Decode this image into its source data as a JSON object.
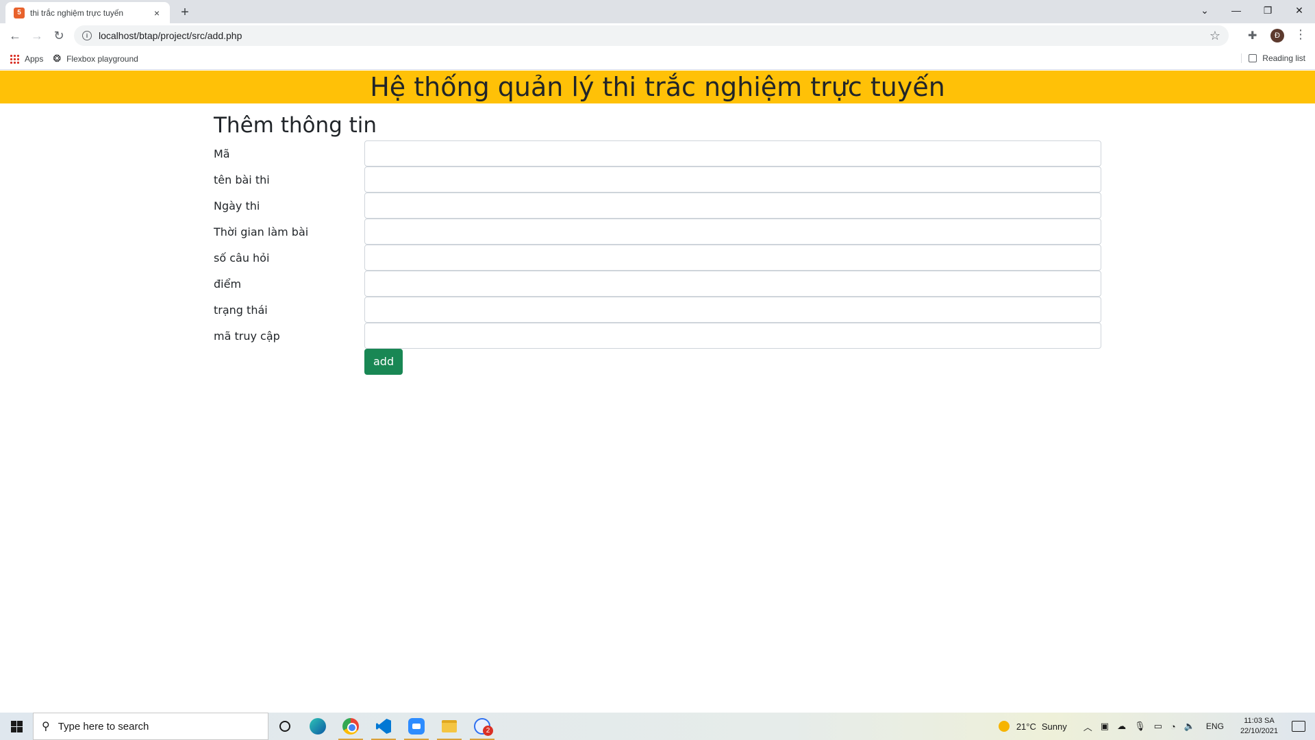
{
  "browser": {
    "tab_title": "thi trắc nghiệm trực tuyến",
    "tab_favicon": "html-icon",
    "tab_close": "×",
    "new_tab": "+",
    "url": "localhost/btap/project/src/add.php",
    "profile_initial": "Đ",
    "window_controls": {
      "tab_search": "⌄",
      "minimize": "—",
      "restore": "❐",
      "close": "✕"
    },
    "bookmarks": [
      {
        "label": "Apps",
        "icon": "apps-grid-icon"
      },
      {
        "label": "Flexbox playground",
        "icon": "flexbox-icon"
      }
    ],
    "reading_list": "Reading list"
  },
  "page": {
    "header_title": "Hệ thống quản lý thi trắc nghiệm trực tuyến",
    "header_color": "#ffc107",
    "form_title": "Thêm thông tin",
    "fields": [
      {
        "label": "Mã",
        "value": ""
      },
      {
        "label": "tên bài thi",
        "value": ""
      },
      {
        "label": "Ngày thi",
        "value": ""
      },
      {
        "label": "Thời gian làm bài",
        "value": ""
      },
      {
        "label": "số câu hỏi",
        "value": ""
      },
      {
        "label": "điểm",
        "value": ""
      },
      {
        "label": "trạng thái",
        "value": ""
      },
      {
        "label": "mã truy cập",
        "value": ""
      }
    ],
    "submit_label": "add",
    "submit_color": "#198754"
  },
  "taskbar": {
    "search_placeholder": "Type here to search",
    "apps": [
      "cortana-icon",
      "edge-icon",
      "chrome-icon",
      "vscode-icon",
      "zoom-icon",
      "file-explorer-icon",
      "zalo-icon"
    ],
    "zalo_badge": "2",
    "weather_temp": "21°C",
    "weather_condition": "Sunny",
    "language": "ENG",
    "time": "11:03 SA",
    "date": "22/10/2021"
  }
}
